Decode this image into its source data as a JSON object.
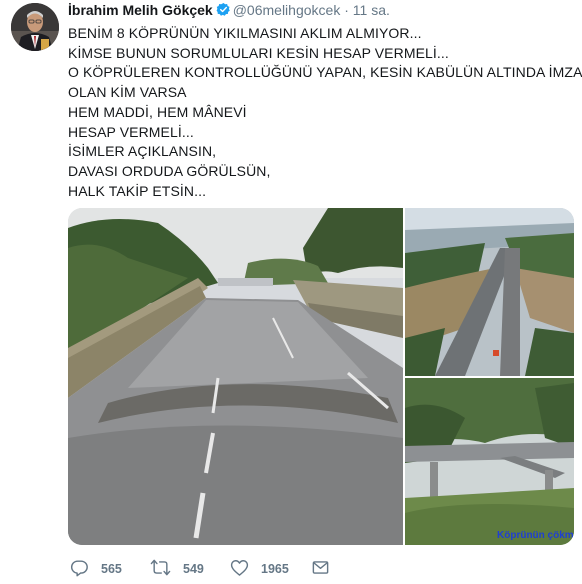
{
  "tweet": {
    "author_name": "İbrahim Melih Gökçek",
    "handle": "@06melihgokcek",
    "separator": "·",
    "time": "11 sa.",
    "lines": [
      "BENİM 8 KÖPRÜNÜN YIKILMASINI AKLIM ALMIYOR...",
      "KİMSE BUNUN SORUMLULARI KESİN HESAP VERMELİ...",
      "O KÖPRÜLEREN KONTROLLÜĞÜNÜ YAPAN, KESİN KABÜLÜN ALTINDA İMZASI",
      "OLAN KİM VARSA",
      "HEM MADDİ, HEM MÂNEVİ",
      "HESAP VERMELİ...",
      "İSİMLER AÇIKLANSIN,",
      "DAVASI ORDUDA GÖRÜLSÜN,",
      "HALK TAKİP ETSİN..."
    ],
    "media_caption": "Köprünün çökm",
    "replies": "565",
    "retweets": "549",
    "likes": "1965"
  },
  "icons": {
    "verified": "verified-badge-icon",
    "reply": "reply-icon",
    "retweet": "retweet-icon",
    "like": "heart-icon",
    "message": "envelope-icon"
  },
  "colors": {
    "verified": "#1da1f2",
    "muted": "#657786",
    "text": "#14171a"
  }
}
